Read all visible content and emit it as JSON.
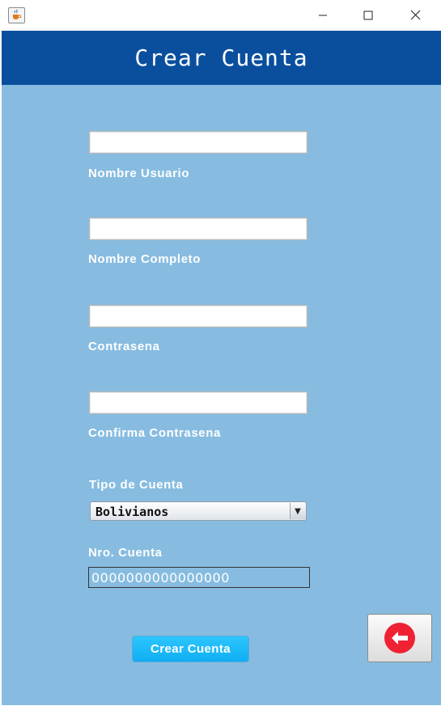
{
  "window": {
    "icon": "java-cup-icon",
    "controls": [
      "minimize-icon",
      "maximize-icon",
      "close-icon"
    ]
  },
  "header": {
    "title": "Crear Cuenta"
  },
  "form": {
    "nombre_usuario": {
      "label": "Nombre Usuario",
      "value": ""
    },
    "nombre_completo": {
      "label": "Nombre Completo",
      "value": ""
    },
    "contrasena": {
      "label": "Contrasena",
      "value": ""
    },
    "confirma_contrasena": {
      "label": "Confirma Contrasena",
      "value": ""
    },
    "tipo_cuenta": {
      "label": "Tipo de Cuenta",
      "selected": "Bolivianos"
    },
    "nro_cuenta": {
      "label": "Nro. Cuenta",
      "value": "0000000000000000"
    }
  },
  "actions": {
    "crear_label": "Crear Cuenta",
    "back_icon": "back-arrow-icon"
  },
  "colors": {
    "header": "#0a4f9e",
    "background": "#87bce0",
    "button": "#10aef2",
    "back_circle": "#ee2233"
  }
}
